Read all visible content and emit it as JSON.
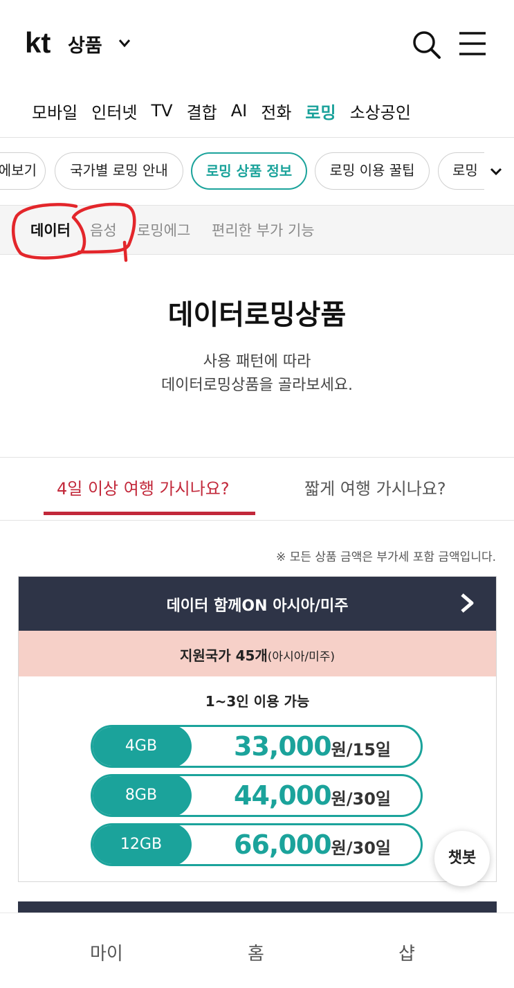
{
  "header": {
    "brand": "kt",
    "title": "상품",
    "icons": [
      "chevron-down-icon",
      "search-icon",
      "menu-icon"
    ]
  },
  "category_nav": {
    "items": [
      "모바일",
      "인터넷",
      "TV",
      "결합",
      "AI",
      "전화",
      "로밍",
      "소상공인"
    ],
    "active": "로밍"
  },
  "pill_tabs": {
    "items": [
      "한눈에보기",
      "국가별 로밍 안내",
      "로밍 상품 정보",
      "로밍 이용 꿀팁",
      "로밍"
    ],
    "active": "로밍 상품 정보"
  },
  "sub_tabs": {
    "items": [
      "데이터",
      "음성",
      "로밍에그",
      "편리한 부가 기능"
    ],
    "active": "데이터"
  },
  "intro": {
    "title": "데이터로밍상품",
    "desc_line1": "사용 패턴에 따라",
    "desc_line2": "데이터로밍상품을 골라보세요."
  },
  "trip_tabs": {
    "active": "4일 이상 여행 가시나요?",
    "inactive": "짧게 여행 가시나요?"
  },
  "vat_note": "※ 모든 상품 금액은 부가세 포함 금액입니다.",
  "product_card": {
    "title": "데이터 함께ON 아시아/미주",
    "countries_main": "지원국가 45개",
    "countries_sub": "(아시아/미주)",
    "users": "1~3인 이용 가능",
    "plans": [
      {
        "data": "4GB",
        "price": "33,000",
        "unit": "원/",
        "period": "15일"
      },
      {
        "data": "8GB",
        "price": "44,000",
        "unit": "원/",
        "period": "30일"
      },
      {
        "data": "12GB",
        "price": "66,000",
        "unit": "원/",
        "period": "30일"
      }
    ]
  },
  "chatbot": {
    "label": "챗봇"
  },
  "bottom_nav": {
    "items": [
      "마이",
      "홈",
      "샵"
    ]
  },
  "colors": {
    "accent": "#1ba39b",
    "red": "#c2283a",
    "card_header": "#2e3447",
    "country_band": "#f6d0c8"
  }
}
